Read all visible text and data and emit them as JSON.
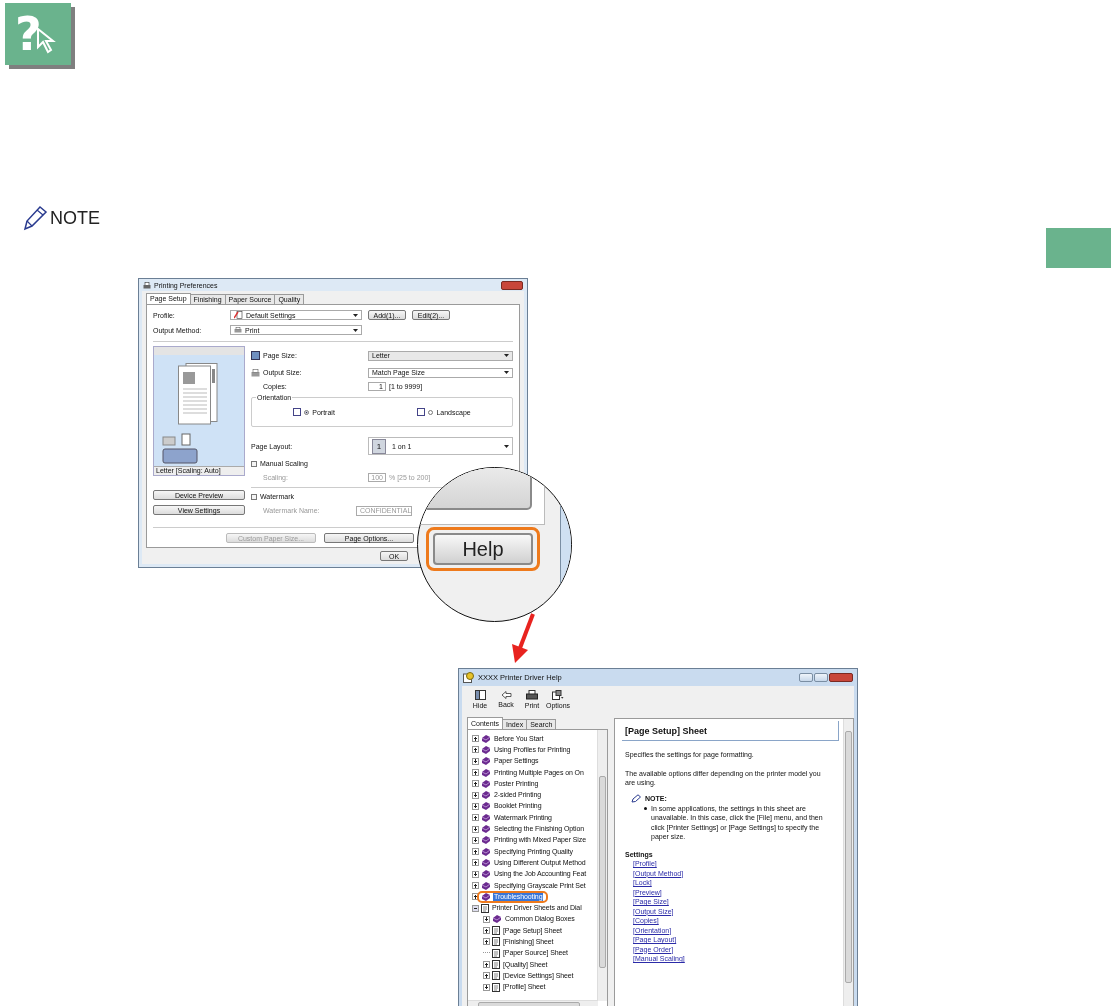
{
  "help_badge": {
    "glyph": "?"
  },
  "note": {
    "label": "NOTE"
  },
  "preferences_dialog": {
    "title": "Printing Preferences",
    "tabs": [
      {
        "label": "Page Setup",
        "selected": true
      },
      {
        "label": "Finishing",
        "selected": false
      },
      {
        "label": "Paper Source",
        "selected": false
      },
      {
        "label": "Quality",
        "selected": false
      }
    ],
    "profile": {
      "label": "Profile:",
      "value": "Default Settings"
    },
    "profile_buttons": [
      "Add(1)...",
      "Edit(2)..."
    ],
    "output_method": {
      "label": "Output Method:",
      "value": "Print"
    },
    "preview_caption": "Letter [Scaling: Auto]",
    "preview_buttons": [
      "Device Preview",
      "View Settings"
    ],
    "page_size": {
      "label": "Page Size:",
      "value": "Letter"
    },
    "output_size": {
      "label": "Output Size:",
      "value": "Match Page Size"
    },
    "copies": {
      "label": "Copies:",
      "value": "1",
      "range": "[1 to 9999]"
    },
    "orientation": {
      "label": "Orientation",
      "options": [
        {
          "label": "Portrait",
          "selected": true
        },
        {
          "label": "Landscape",
          "selected": false
        }
      ]
    },
    "page_layout": {
      "label": "Page Layout:",
      "badge": "1",
      "value": "1 on 1"
    },
    "manual_scaling": {
      "label": "Manual Scaling",
      "checked": false
    },
    "scaling": {
      "label": "Scaling:",
      "value": "100",
      "range": "% [25 to 200]",
      "disabled": true
    },
    "watermark": {
      "label": "Watermark",
      "checked": false
    },
    "watermark_name": {
      "label": "Watermark Name:",
      "value": "CONFIDENTIAL",
      "disabled": true
    },
    "bottom_buttons": [
      {
        "label": "Custom Paper Size...",
        "disabled": true
      },
      {
        "label": "Page Options...",
        "disabled": false
      }
    ],
    "ok_button": "OK"
  },
  "magnifier": {
    "button": "Help"
  },
  "help_window": {
    "title": "XXXX Printer Driver Help",
    "toolbar": [
      {
        "label": "Hide",
        "kind": "hide"
      },
      {
        "label": "Back",
        "kind": "back"
      },
      {
        "label": "Print",
        "kind": "print"
      },
      {
        "label": "Options",
        "kind": "options"
      }
    ],
    "tabs": [
      {
        "label": "Contents",
        "selected": true
      },
      {
        "label": "Index",
        "selected": false
      },
      {
        "label": "Search",
        "selected": false
      }
    ],
    "tree": [
      {
        "label": "Before You Start",
        "kind": "book",
        "expandable": true,
        "expanded": false,
        "selected": false
      },
      {
        "label": "Using Profiles for Printing",
        "kind": "book",
        "expandable": true,
        "expanded": false,
        "selected": false
      },
      {
        "label": "Paper Settings",
        "kind": "book",
        "expandable": true,
        "expanded": false,
        "selected": false
      },
      {
        "label": "Printing Multiple Pages on On",
        "kind": "book",
        "expandable": true,
        "expanded": false,
        "selected": false
      },
      {
        "label": "Poster Printing",
        "kind": "book",
        "expandable": true,
        "expanded": false,
        "selected": false
      },
      {
        "label": "2-sided Printing",
        "kind": "book",
        "expandable": true,
        "expanded": false,
        "selected": false
      },
      {
        "label": "Booklet Printing",
        "kind": "book",
        "expandable": true,
        "expanded": false,
        "selected": false
      },
      {
        "label": "Watermark Printing",
        "kind": "book",
        "expandable": true,
        "expanded": false,
        "selected": false
      },
      {
        "label": "Selecting the Finishing Option",
        "kind": "book",
        "expandable": true,
        "expanded": false,
        "selected": false
      },
      {
        "label": "Printing with Mixed Paper Size",
        "kind": "book",
        "expandable": true,
        "expanded": false,
        "selected": false
      },
      {
        "label": "Specifying Printing Quality",
        "kind": "book",
        "expandable": true,
        "expanded": false,
        "selected": false
      },
      {
        "label": "Using Different Output Method",
        "kind": "book",
        "expandable": true,
        "expanded": false,
        "selected": false
      },
      {
        "label": "Using the Job Accounting Feat",
        "kind": "book",
        "expandable": true,
        "expanded": false,
        "selected": false
      },
      {
        "label": "Specifying Grayscale Print Set",
        "kind": "book",
        "expandable": true,
        "expanded": false,
        "selected": false
      },
      {
        "label": "Troubleshooting",
        "kind": "book",
        "expandable": true,
        "expanded": false,
        "selected": true
      },
      {
        "label": "Printer Driver Sheets and Dial",
        "kind": "page",
        "expandable": true,
        "expanded": true,
        "selected": false,
        "children": [
          {
            "label": "Common Dialog Boxes",
            "kind": "book",
            "expandable": true,
            "expanded": false,
            "selected": false
          },
          {
            "label": "[Page Setup] Sheet",
            "kind": "page",
            "expandable": true,
            "expanded": false,
            "selected": false
          },
          {
            "label": "[Finishing] Sheet",
            "kind": "page",
            "expandable": true,
            "expanded": false,
            "selected": false
          },
          {
            "label": "[Paper Source] Sheet",
            "kind": "page",
            "expandable": false,
            "selected": false
          },
          {
            "label": "[Quality] Sheet",
            "kind": "page",
            "expandable": true,
            "expanded": false,
            "selected": false
          },
          {
            "label": "[Device Settings] Sheet",
            "kind": "page",
            "expandable": true,
            "expanded": false,
            "selected": false
          },
          {
            "label": "[Profile] Sheet",
            "kind": "page",
            "expandable": true,
            "expanded": false,
            "selected": false
          }
        ]
      }
    ],
    "heading": "[Page Setup] Sheet",
    "paragraphs": [
      "Specifies the settings for page formatting.",
      "The available options differ depending on the printer model you are using."
    ],
    "note": {
      "title": "NOTE:",
      "items": [
        "In some applications, the settings in this sheet are unavailable. In this case, click the [File] menu, and then click [Printer Settings] or [Page Settings] to specify the paper size."
      ]
    },
    "settings_title": "Settings",
    "links": [
      "[Profile]",
      "[Output Method]",
      "[Lock]",
      "[Preview]",
      "[Page Size]",
      "[Output Size]",
      "[Copies]",
      "[Orientation]",
      "[Page Layout]",
      "[Page Order]",
      "[Manual Scaling]"
    ]
  }
}
